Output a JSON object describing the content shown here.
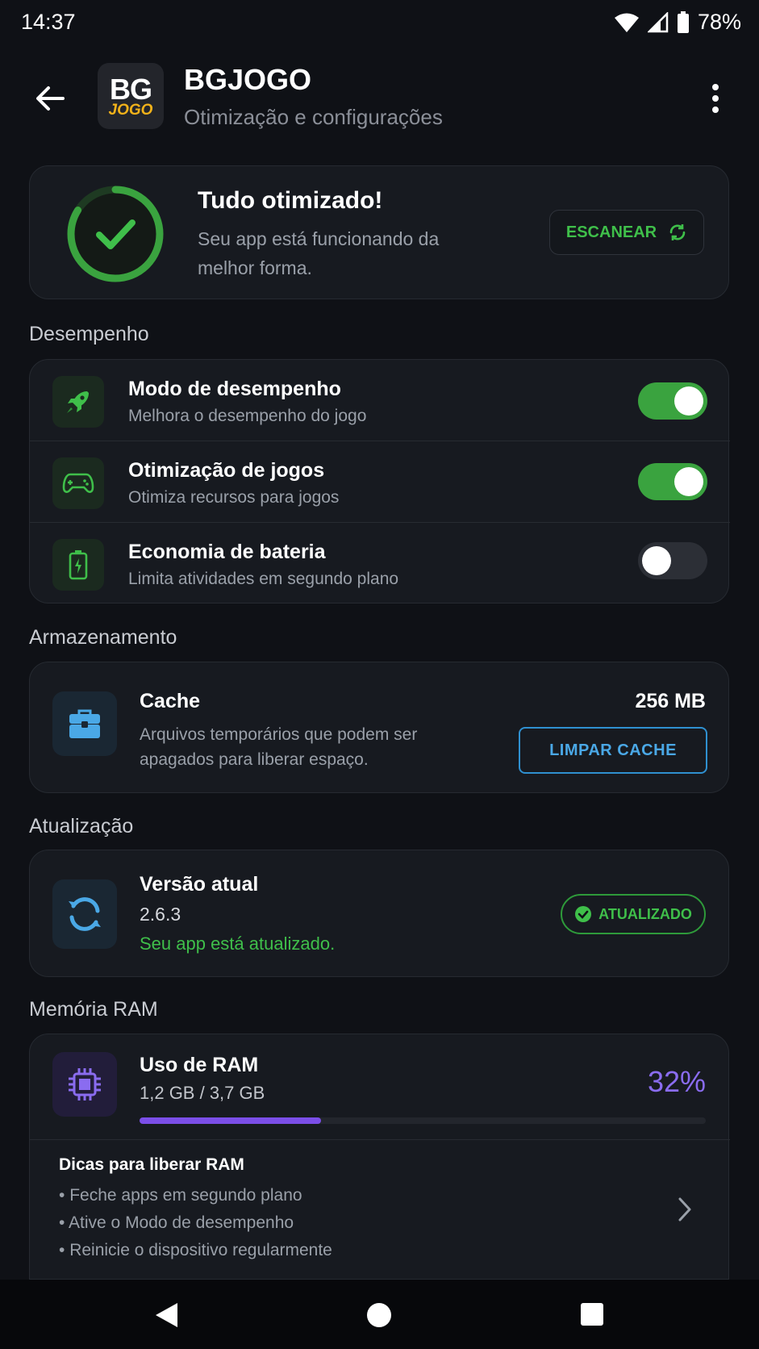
{
  "status": {
    "time": "14:37",
    "battery": "78%"
  },
  "app": {
    "logo_bg": "BG",
    "logo_jogo": "JOGO",
    "title": "BGJOGO",
    "subtitle": "Otimização e configurações"
  },
  "hero": {
    "title": "Tudo otimizado!",
    "subtitle": "Seu app está funcionando da melhor forma.",
    "scan_label": "ESCANEAR",
    "accent": "#3fbf4a"
  },
  "sections": {
    "performance": "Desempenho",
    "storage": "Armazenamento",
    "update": "Atualização",
    "ram": "Memória RAM"
  },
  "performance_items": [
    {
      "title": "Modo de desempenho",
      "subtitle": "Melhora o desempenho do jogo",
      "icon": "rocket-icon",
      "enabled": true
    },
    {
      "title": "Otimização de jogos",
      "subtitle": "Otimiza recursos para jogos",
      "icon": "gamepad-icon",
      "enabled": true
    },
    {
      "title": "Economia de bateria",
      "subtitle": "Limita atividades em segundo plano",
      "icon": "battery-icon",
      "enabled": false
    }
  ],
  "storage": {
    "title": "Cache",
    "size": "256 MB",
    "subtitle": "Arquivos temporários que podem ser apagados para liberar espaço.",
    "button": "LIMPAR CACHE"
  },
  "update": {
    "title": "Versão atual",
    "version": "2.6.3",
    "status": "Seu app está atualizado.",
    "badge": "ATUALIZADO"
  },
  "ram": {
    "title": "Uso de RAM",
    "usage": "1,2 GB / 3,7 GB",
    "percent_label": "32%",
    "fill_fraction": 0.32,
    "tips_title": "Dicas para liberar RAM",
    "tips": [
      "Feche apps em segundo plano",
      "Ative o Modo de desempenho",
      "Reinicie o dispositivo regularmente"
    ]
  },
  "colors": {
    "green": "#3aa33f",
    "blue": "#4aa8e6",
    "purple": "#8a6cf0",
    "background": "#0f1116"
  }
}
